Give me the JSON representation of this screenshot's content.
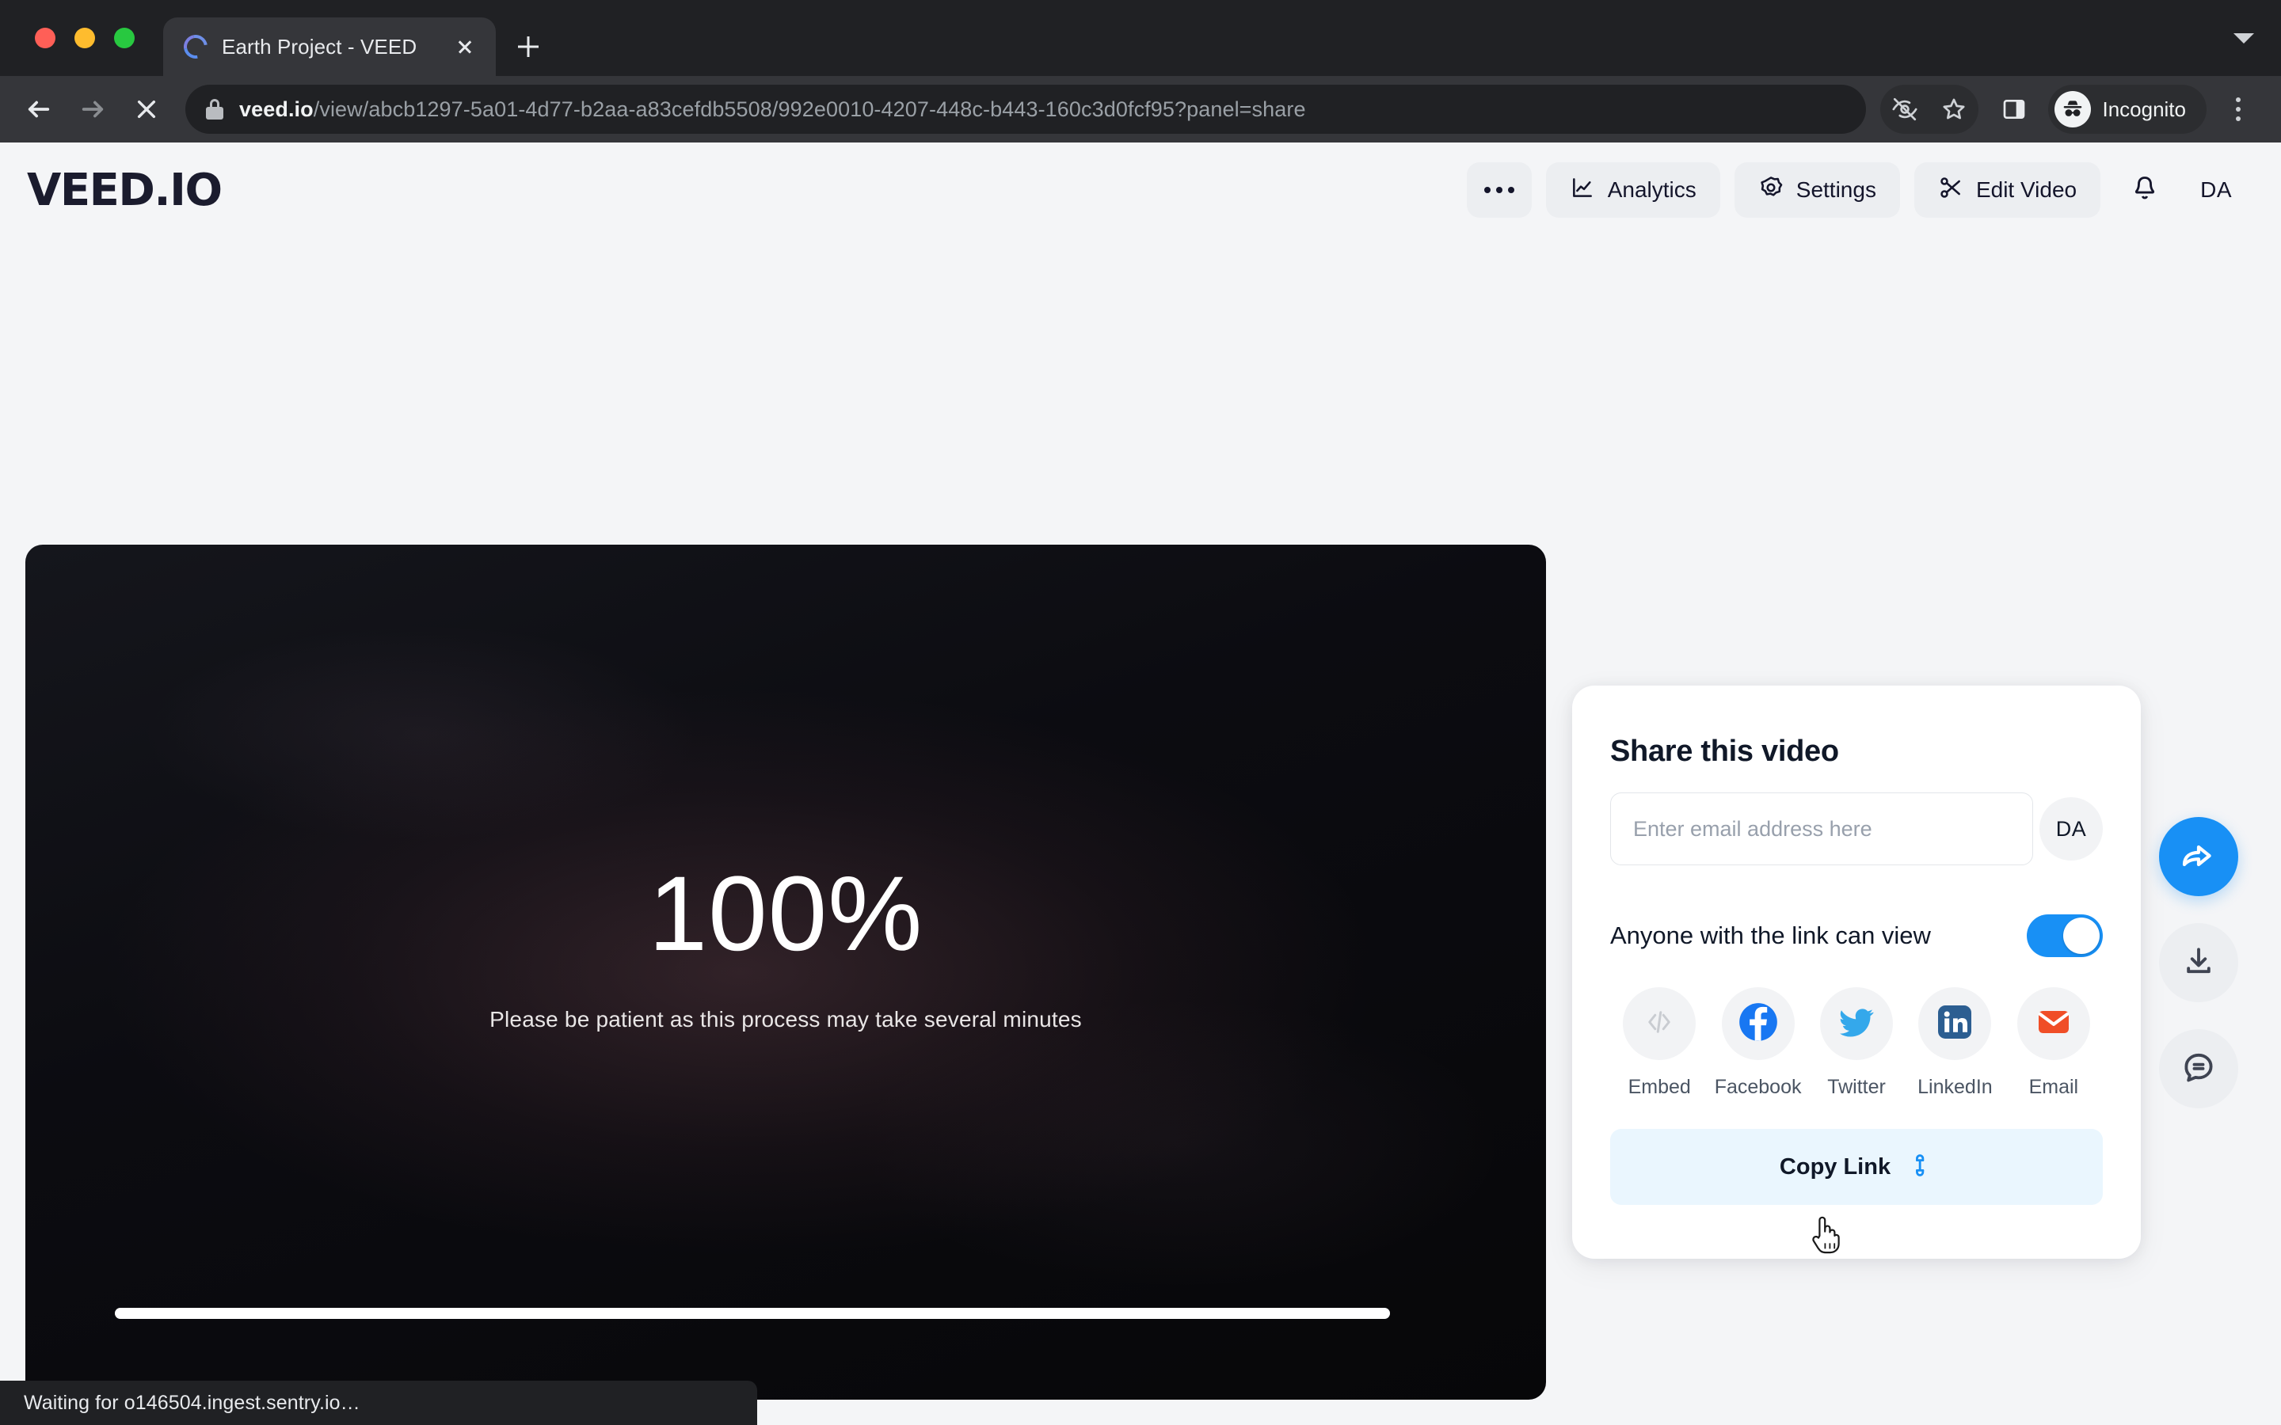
{
  "browser": {
    "tab": {
      "title": "Earth Project - VEED",
      "favicon": "loading-spinner-icon",
      "close": "×"
    },
    "new_tab_tooltip": "New Tab",
    "url_host": "veed.io",
    "url_path": "/view/abcb1297-5a01-4d77-b2aa-a83cefdb5508/992e0010-4207-448c-b443-160c3d0fcf95?panel=share",
    "profile_label": "Incognito",
    "status_text": "Waiting for o146504.ingest.sentry.io…"
  },
  "app": {
    "logo": "VEED.IO",
    "header_buttons": [
      {
        "label": "",
        "icon": "more-horizontal-icon",
        "name": "more-options-button"
      },
      {
        "label": "Analytics",
        "icon": "chart-line-icon",
        "name": "analytics-button"
      },
      {
        "label": "Settings",
        "icon": "gear-icon",
        "name": "settings-button"
      },
      {
        "label": "Edit Video",
        "icon": "scissors-icon",
        "name": "edit-video-button"
      }
    ],
    "notifications_icon": "bell-icon",
    "avatar_initials": "DA"
  },
  "video": {
    "percent": "100%",
    "message": "Please be patient as this process may take several minutes",
    "progress_value": 100
  },
  "share_panel": {
    "title": "Share this video",
    "email_placeholder": "Enter email address here",
    "email_value": "",
    "avatar_initials": "DA",
    "link_permission_label": "Anyone with the link can view",
    "link_permission_on": true,
    "socials": [
      {
        "label": "Embed",
        "icon": "code-brackets-icon",
        "color": "#c9ccd1"
      },
      {
        "label": "Facebook",
        "icon": "facebook-icon",
        "color": "#1877F2"
      },
      {
        "label": "Twitter",
        "icon": "twitter-bird-icon",
        "color": "#34A8EB"
      },
      {
        "label": "LinkedIn",
        "icon": "linkedin-icon",
        "color": "#2C5E91"
      },
      {
        "label": "Email",
        "icon": "envelope-icon",
        "color": "#F04E27"
      }
    ],
    "copy_label": "Copy Link",
    "copy_icon": "link-chain-icon"
  },
  "rail": [
    {
      "name": "share-fab",
      "icon": "share-arrow-icon",
      "active": true
    },
    {
      "name": "download-fab",
      "icon": "download-icon",
      "active": false
    },
    {
      "name": "comment-fab",
      "icon": "comment-icon",
      "active": false
    }
  ],
  "colors": {
    "accent_blue": "#1890f5",
    "chrome_dark": "#202124",
    "page_bg": "#f4f5f7",
    "copy_btn_bg": "#eaf6fe"
  }
}
